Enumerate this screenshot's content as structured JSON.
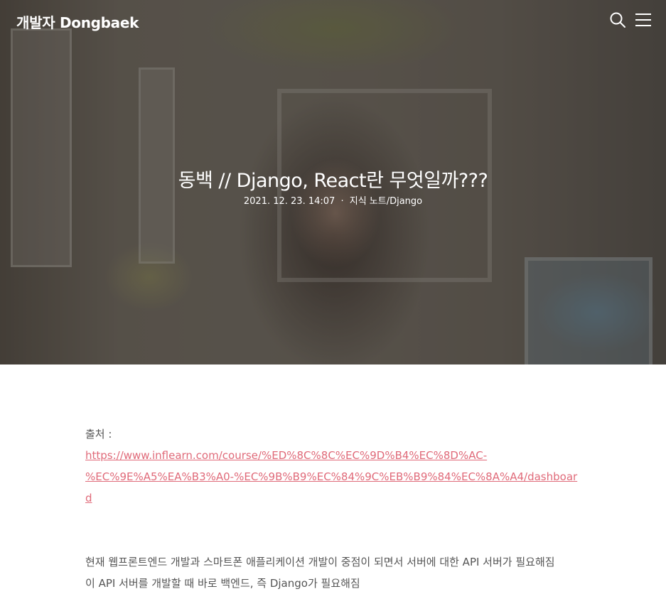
{
  "header": {
    "brand": "개발자 Dongbaek",
    "search_icon": "search-icon",
    "menu_icon": "hamburger-menu-icon"
  },
  "post": {
    "title": "동백 // Django, React란 무엇일까???",
    "date": "2021. 12. 23. 14:07",
    "separator": "·",
    "category": "지식 노트/Django"
  },
  "article": {
    "source_label": "출처 :",
    "source_link_line1": "https://www.inflearn.com/course/%ED%8C%8C%EC%9D%B4%EC%8D%AC-",
    "source_link_line2": "%EC%9E%A5%EA%B3%A0-%EC%9B%B9%EC%84%9C%EB%B9%84%EC%8A%A4/dashboard",
    "paragraph1": "현재 웹프론트엔드 개발과 스마트폰 애플리케이션 개발이 중점이 되면서 서버에 대한 API 서버가 필요해짐",
    "paragraph2": "이 API 서버를 개발할 때 바로 백엔드, 즉 Django가 필요해짐"
  },
  "colors": {
    "link": "#e06a79",
    "body_text": "#555555",
    "header_text": "#ffffff"
  }
}
